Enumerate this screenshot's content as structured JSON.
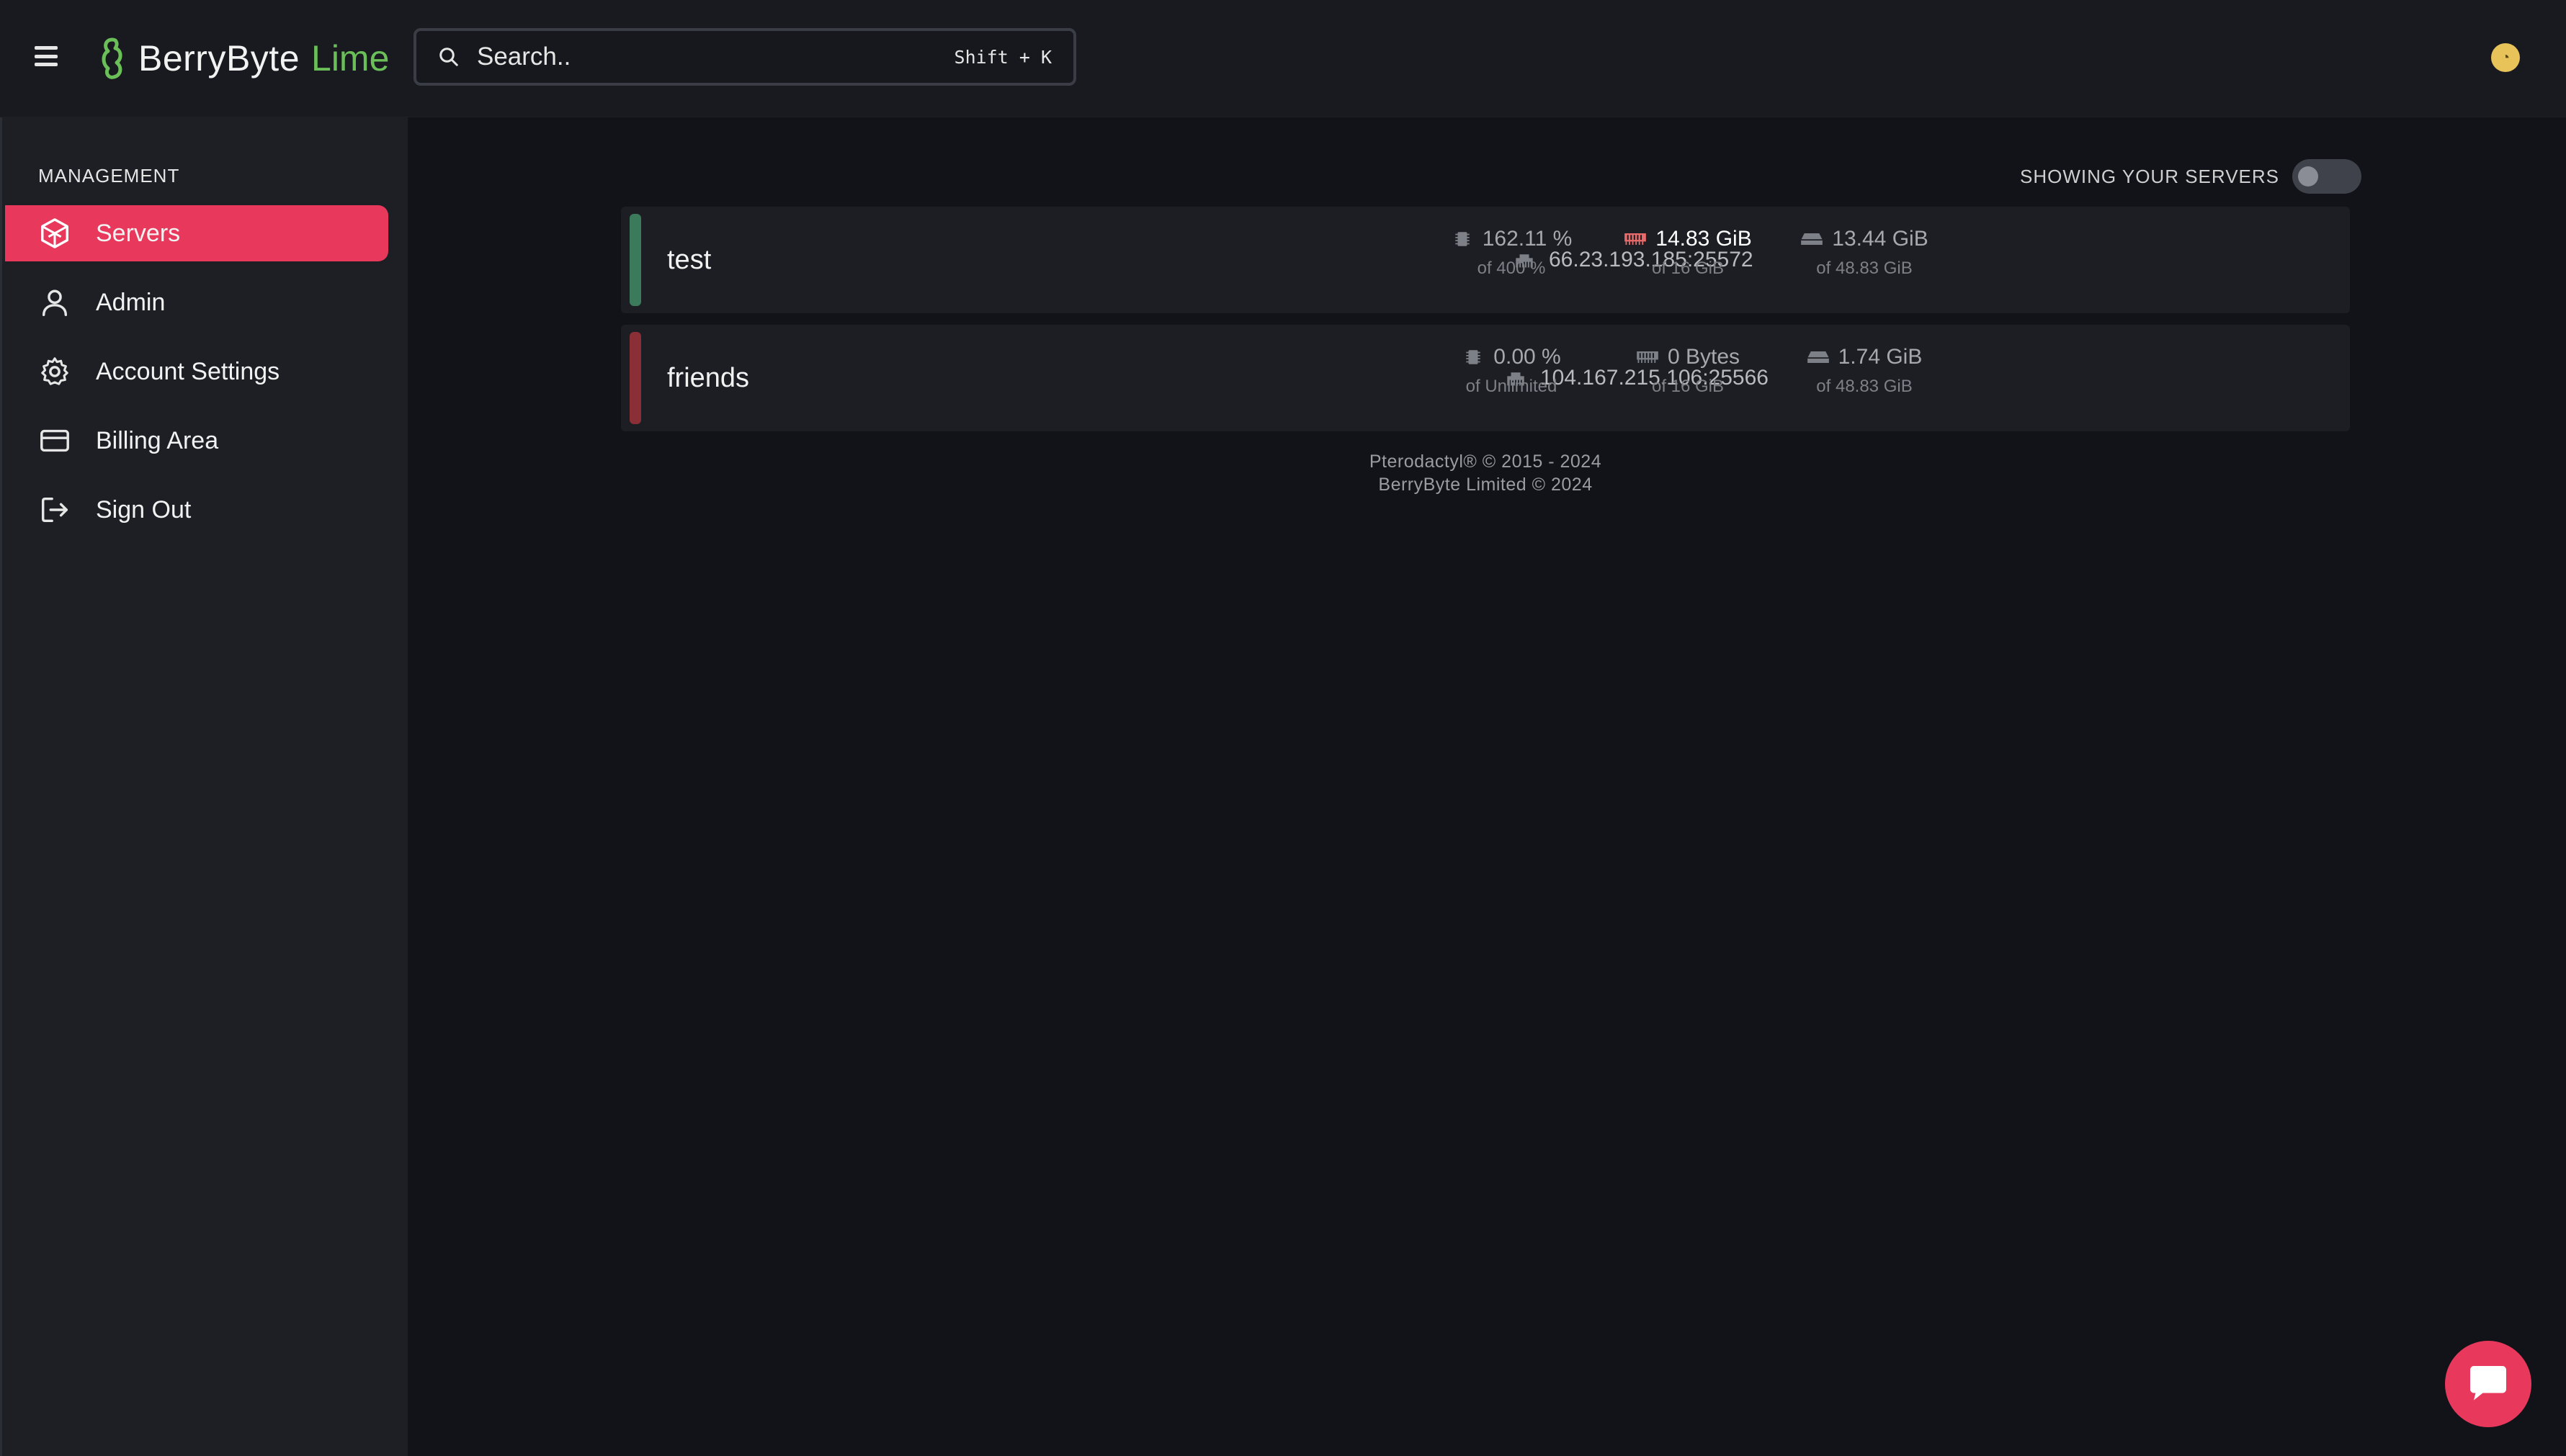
{
  "header": {
    "brand": "BerryByte",
    "brand_accent": "Lime",
    "search": {
      "placeholder": "Search..",
      "shortcut": "Shift + K"
    }
  },
  "sidebar": {
    "section_label": "MANAGEMENT",
    "items": [
      {
        "label": "Servers",
        "icon": "servers-icon",
        "active": true
      },
      {
        "label": "Admin",
        "icon": "user-icon",
        "active": false
      },
      {
        "label": "Account Settings",
        "icon": "gear-icon",
        "active": false
      },
      {
        "label": "Billing Area",
        "icon": "credit-card-icon",
        "active": false
      },
      {
        "label": "Sign Out",
        "icon": "sign-out-icon",
        "active": false
      }
    ]
  },
  "main": {
    "toggle_label": "SHOWING YOUR SERVERS",
    "servers": [
      {
        "name": "test",
        "status_color": "#3b7a5a",
        "ip": "66.23.193.185:25572",
        "cpu": "162.11 %",
        "cpu_limit": "of 400 %",
        "memory": "14.83 GiB",
        "memory_limit": "of 16 GiB",
        "disk": "13.44 GiB",
        "disk_limit": "of 48.83 GiB"
      },
      {
        "name": "friends",
        "status_color": "#8a2f35",
        "ip": "104.167.215.106:25566",
        "cpu": "0.00 %",
        "cpu_limit": "of Unlimited",
        "memory": "0 Bytes",
        "memory_limit": "of 16 GiB",
        "disk": "1.74 GiB",
        "disk_limit": "of 48.83 GiB"
      }
    ],
    "footer": {
      "line1": "Pterodactyl® © 2015 - 2024",
      "line2": "BerryByte Limited © 2024"
    }
  },
  "colors": {
    "accent": "#e8395c",
    "brand_green": "#6bbf59",
    "memory_alert": "#e86a6a"
  }
}
